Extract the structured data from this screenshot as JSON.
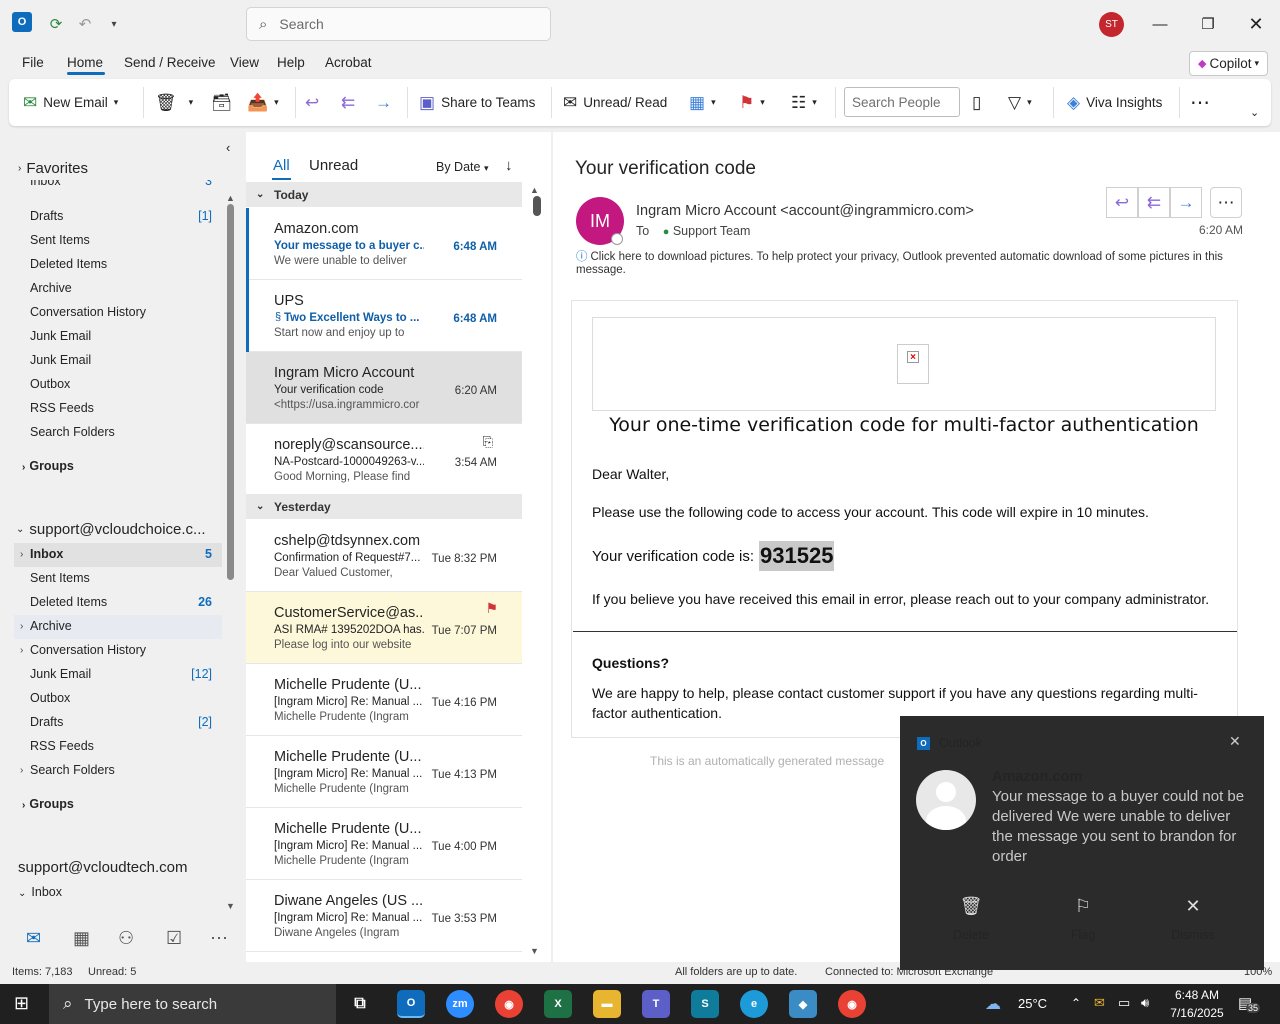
{
  "titlebar": {
    "search_placeholder": "Search",
    "user_initials": "ST"
  },
  "menu": {
    "items": [
      "File",
      "Home",
      "Send / Receive",
      "View",
      "Help",
      "Acrobat"
    ],
    "copilot": "Copilot"
  },
  "ribbon": {
    "new_email": "New Email",
    "share_teams": "Share to Teams",
    "unread_read": "Unread/ Read",
    "search_people_placeholder": "Search People",
    "viva": "Viva Insights"
  },
  "folders": {
    "favorites": "Favorites",
    "fav_items": [
      {
        "label": "Inbox",
        "count": "3"
      },
      {
        "label": "Drafts",
        "count": "[1]"
      },
      {
        "label": "Sent Items",
        "count": ""
      },
      {
        "label": "Deleted Items",
        "count": ""
      },
      {
        "label": "Archive",
        "count": ""
      },
      {
        "label": "Conversation History",
        "count": ""
      },
      {
        "label": "Junk Email",
        "count": ""
      },
      {
        "label": "Junk Email",
        "count": ""
      },
      {
        "label": "Outbox",
        "count": ""
      },
      {
        "label": "RSS Feeds",
        "count": ""
      },
      {
        "label": "Search Folders",
        "count": ""
      },
      {
        "label": "Groups",
        "count": ""
      }
    ],
    "account1": "support@vcloudchoice.c...",
    "acc1_items": [
      {
        "label": "Inbox",
        "count": "5"
      },
      {
        "label": "Sent Items",
        "count": ""
      },
      {
        "label": "Deleted Items",
        "count": "26"
      },
      {
        "label": "Archive",
        "count": ""
      },
      {
        "label": "Conversation History",
        "count": ""
      },
      {
        "label": "Junk Email",
        "count": "[12]"
      },
      {
        "label": "Outbox",
        "count": ""
      },
      {
        "label": "Drafts",
        "count": "[2]"
      },
      {
        "label": "RSS Feeds",
        "count": ""
      },
      {
        "label": "Search Folders",
        "count": ""
      },
      {
        "label": "Groups",
        "count": ""
      }
    ],
    "account2": "support@vcloudtech.com",
    "acc2_inbox": "Inbox"
  },
  "msglist": {
    "tab_all": "All",
    "tab_unread": "Unread",
    "sort": "By Date",
    "group_today": "Today",
    "group_yesterday": "Yesterday",
    "today": [
      {
        "sender": "Amazon.com",
        "subject": "Your message to a buyer c...",
        "preview": "We were unable to deliver",
        "time": "6:48 AM"
      },
      {
        "sender": "UPS",
        "subject": "Two Excellent Ways to ...",
        "preview": "Start now and enjoy up to",
        "time": "6:48 AM"
      },
      {
        "sender": "Ingram Micro Account",
        "subject": "Your verification code",
        "preview": "<https://usa.ingrammicro.cor",
        "time": "6:20 AM"
      },
      {
        "sender": "noreply@scansource....",
        "subject": "NA-Postcard-1000049263-v...",
        "preview": "Good Morning, Please find",
        "time": "3:54 AM"
      }
    ],
    "yesterday": [
      {
        "sender": "cshelp@tdsynnex.com",
        "subject": "Confirmation of Request#7...",
        "preview": "Dear Valued Customer,",
        "time": "Tue 8:32 PM"
      },
      {
        "sender": "CustomerService@as...",
        "subject": "ASI RMA# 1395202DOA has...",
        "preview": "Please log into our website",
        "time": "Tue 7:07 PM"
      },
      {
        "sender": "Michelle Prudente (U...",
        "subject": "[Ingram Micro] Re: Manual ...",
        "preview": "Michelle Prudente (Ingram",
        "time": "Tue 4:16 PM"
      },
      {
        "sender": "Michelle Prudente (U...",
        "subject": "[Ingram Micro] Re: Manual ...",
        "preview": "Michelle Prudente (Ingram",
        "time": "Tue 4:13 PM"
      },
      {
        "sender": "Michelle Prudente (U...",
        "subject": "[Ingram Micro] Re: Manual ...",
        "preview": "Michelle Prudente (Ingram",
        "time": "Tue 4:00 PM"
      },
      {
        "sender": "Diwane Angeles (US ...",
        "subject": "[Ingram Micro] Re: Manual ...",
        "preview": "Diwane Angeles (Ingram",
        "time": "Tue 3:53 PM"
      }
    ]
  },
  "reading": {
    "subject": "Your verification code",
    "avatar": "IM",
    "from": "Ingram Micro Account <account@ingrammicro.com>",
    "to_label": "To",
    "to": "Support Team",
    "time": "6:20 AM",
    "info": "Click here to download pictures. To help protect your privacy, Outlook prevented automatic download of some pictures in this message.",
    "heading": "Your one-time verification code for multi-factor authentication",
    "greeting": "Dear Walter,",
    "para1": "Please use the following code to access your account. This code will expire in 10 minutes.",
    "code_label": "Your verification code is:",
    "code": "931525",
    "para2": "If you believe you have received this email in error, please reach out to your company administrator.",
    "questions": "Questions?",
    "para3": "We are happy to help, please contact customer support if you have any questions regarding multi-factor authentication.",
    "auto_msg": "This is an automatically generated message"
  },
  "toast": {
    "app": "Outlook",
    "title": "Amazon.com",
    "body": "Your message to a buyer could not be delivered We were unable to deliver the message you sent to brandon for order",
    "delete": "Delete",
    "flag": "Flag",
    "dismiss": "Dismiss"
  },
  "status": {
    "items": "Items: 7,183",
    "unread": "Unread: 5",
    "sync": "All folders are up to date.",
    "connected": "Connected to: Microsoft Exchange",
    "zoom": "100%"
  },
  "taskbar": {
    "search": "Type here to search",
    "temp": "25°C",
    "time": "6:48 AM",
    "date": "7/16/2025",
    "notif": "35"
  }
}
